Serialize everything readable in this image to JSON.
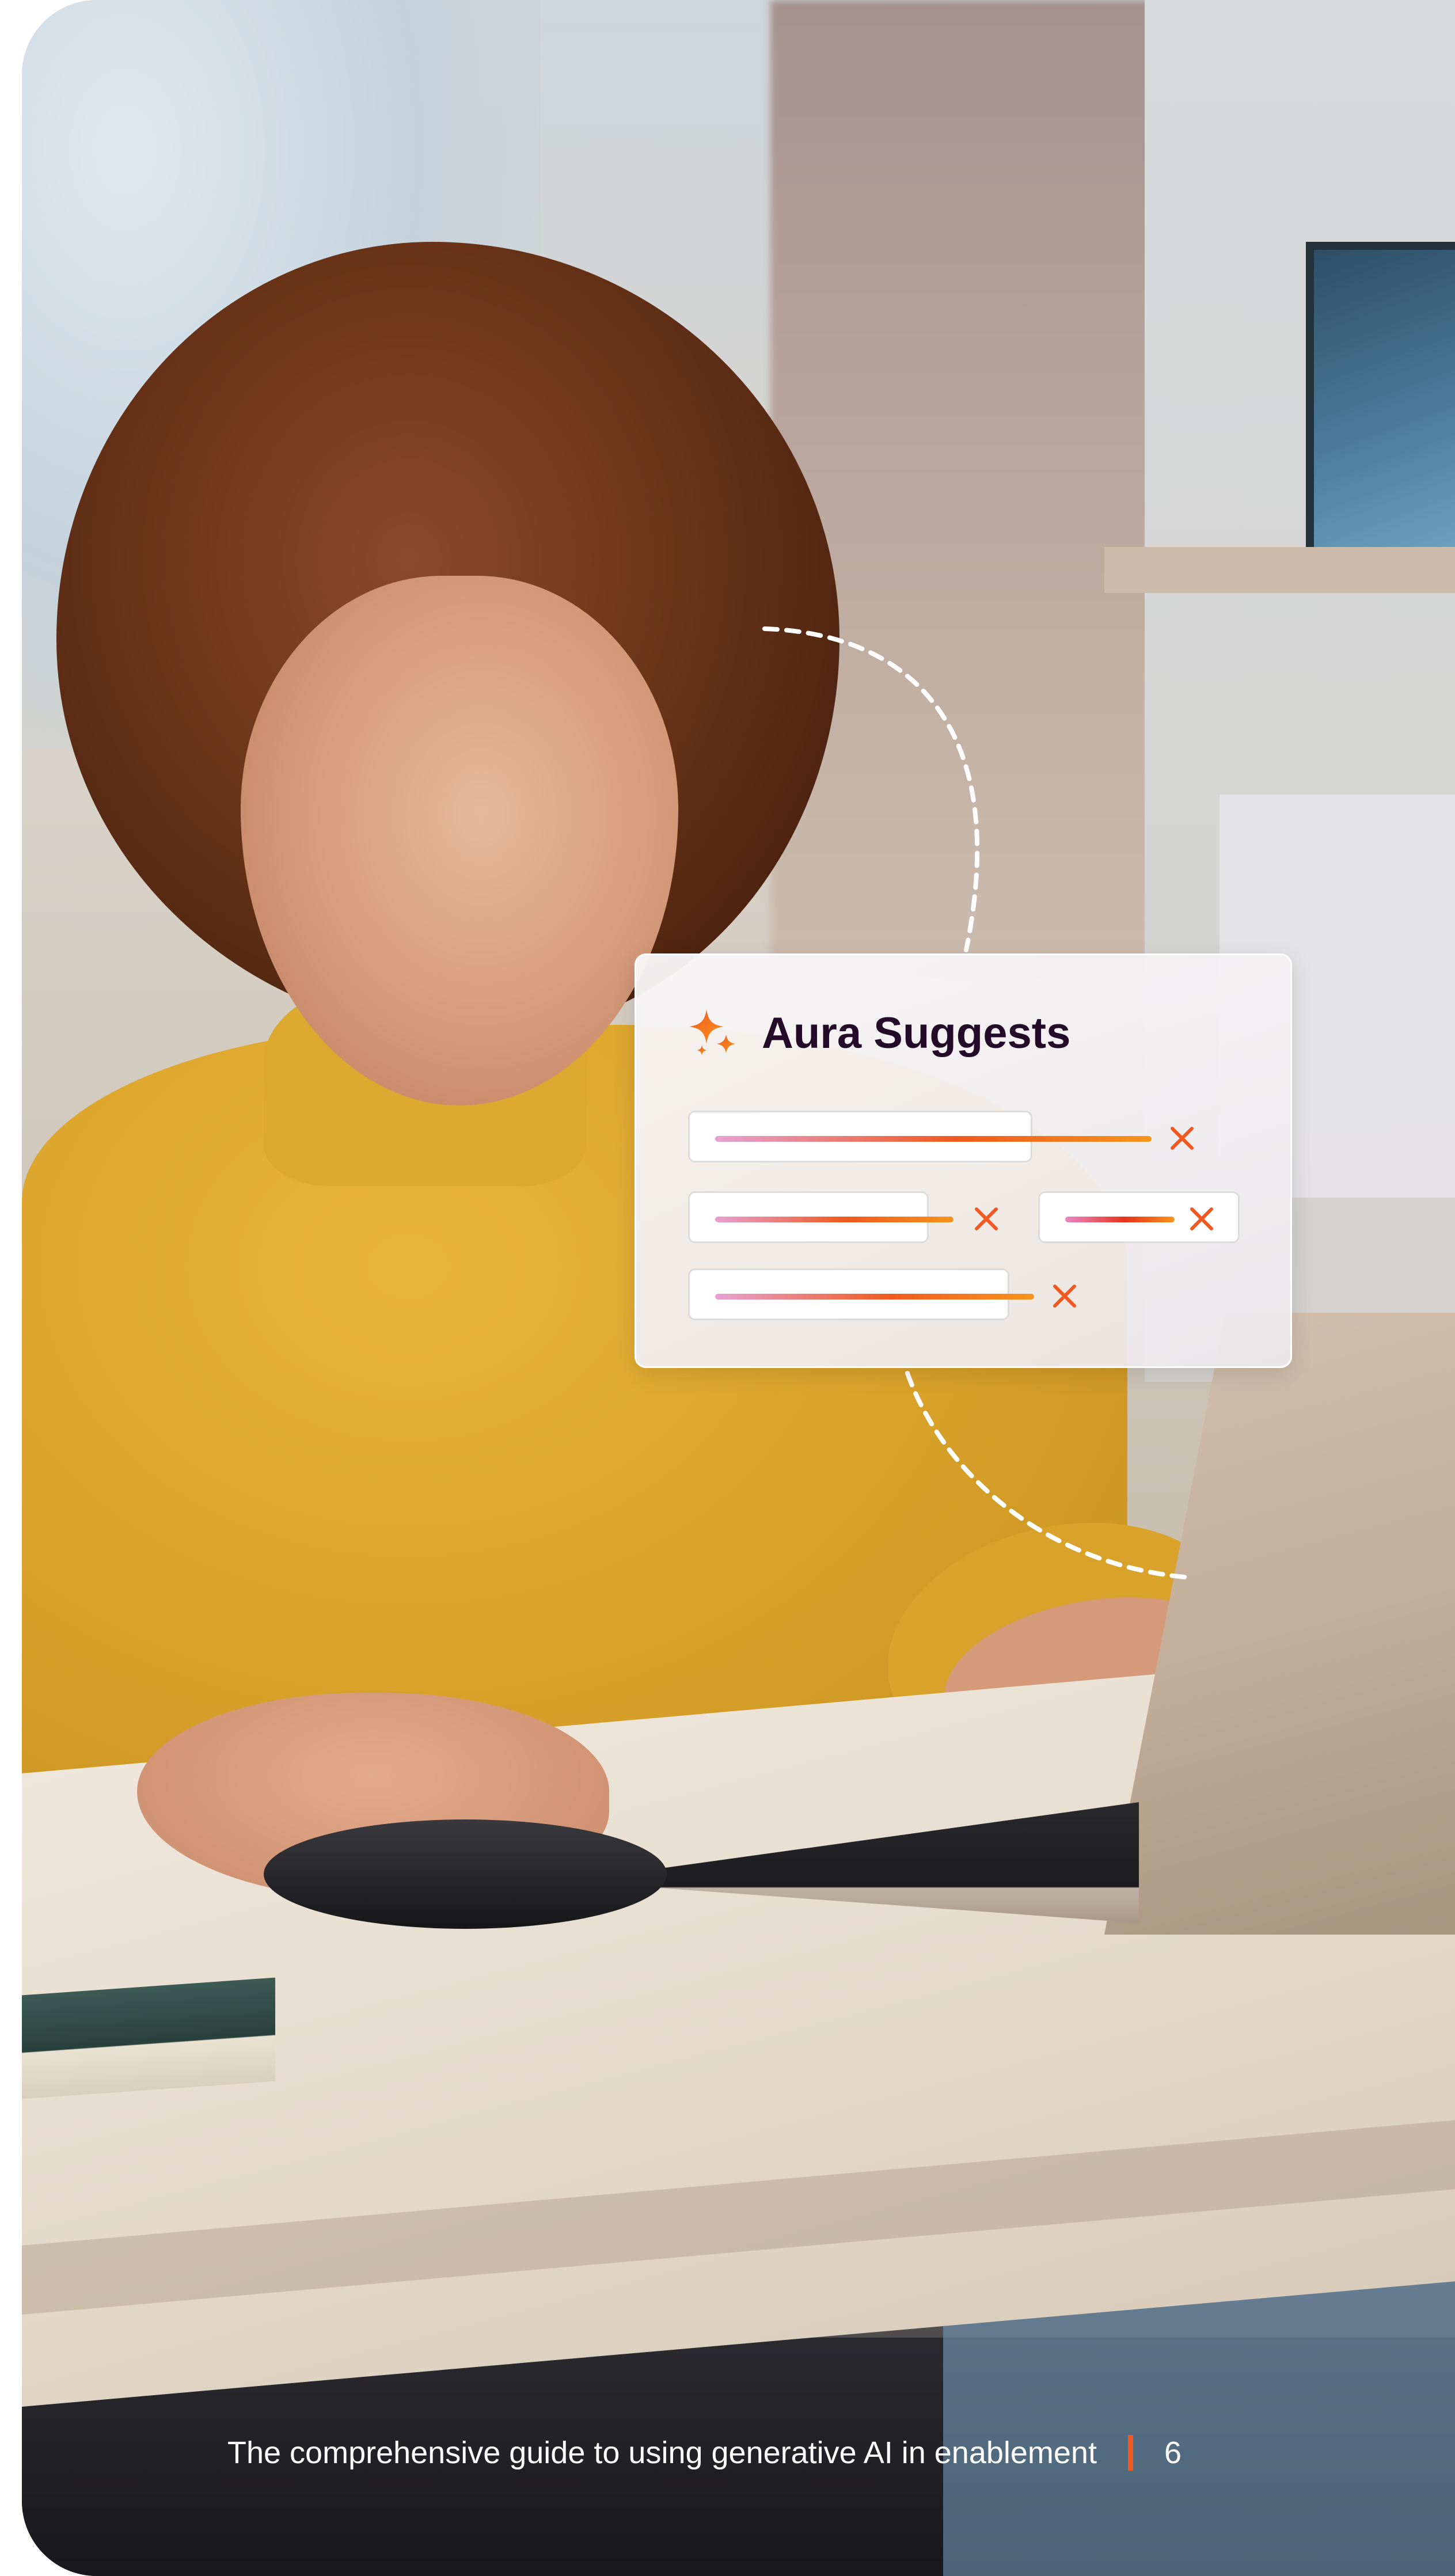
{
  "card": {
    "title": "Aura Suggests",
    "icon": "sparkle-icon",
    "chips": [
      {
        "icon": "close-icon"
      },
      {
        "icon": "close-icon"
      },
      {
        "icon": "close-icon"
      },
      {
        "icon": "close-icon"
      }
    ]
  },
  "footer": {
    "text": "The comprehensive guide to using generative AI in enablement",
    "page_number": "6"
  },
  "colors": {
    "accent": "#f05a22",
    "title": "#240b2a",
    "gradient_start": "#e7a1d3",
    "gradient_end": "#f7941d"
  }
}
